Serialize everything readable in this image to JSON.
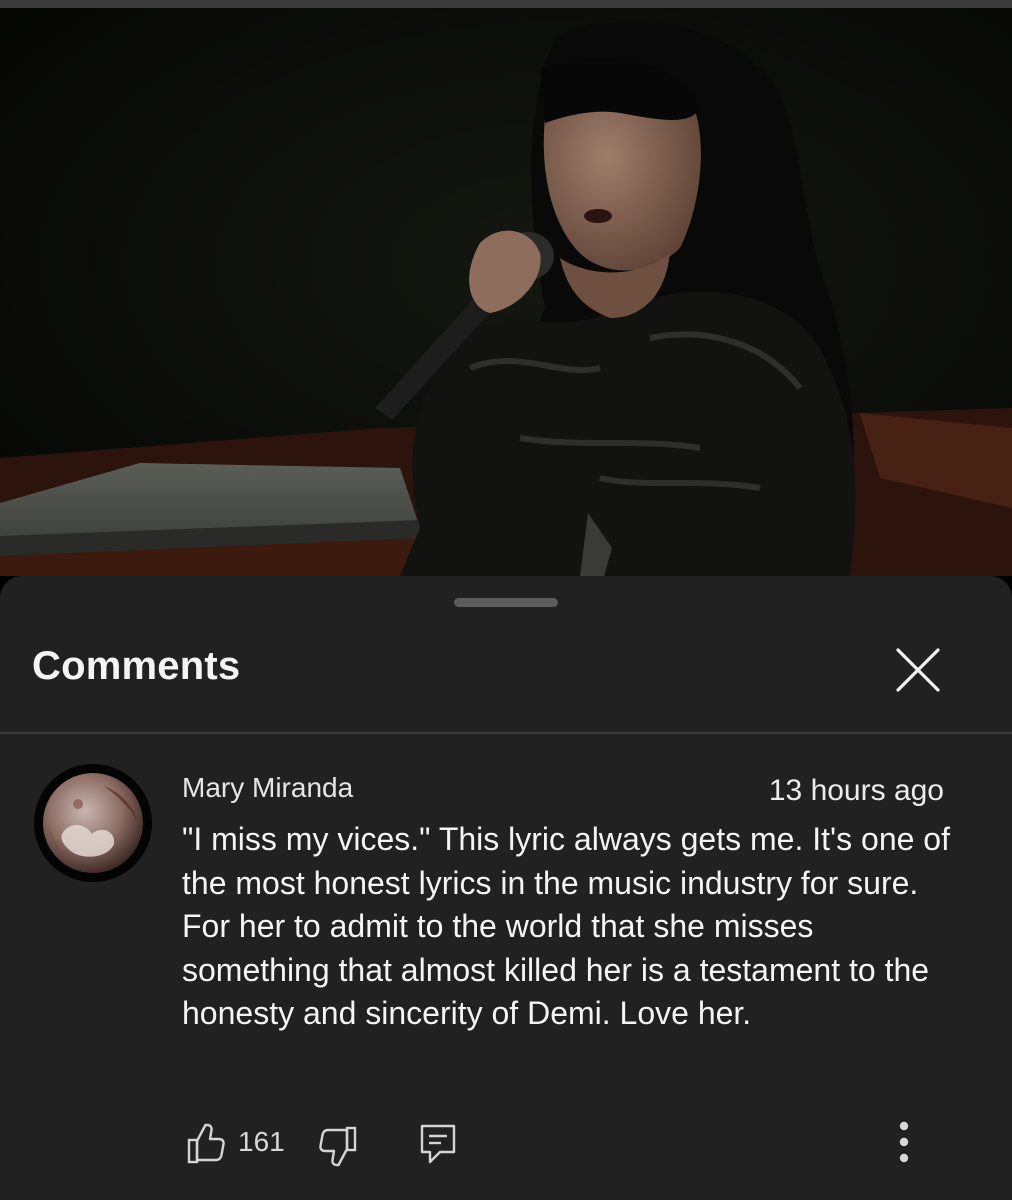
{
  "sheet": {
    "title": "Comments"
  },
  "icons": {
    "close": "close-icon",
    "like": "thumbs-up-icon",
    "dislike": "thumbs-down-icon",
    "reply": "reply-icon",
    "more": "more-vertical-icon"
  },
  "comment": {
    "author": "Mary Miranda",
    "timestamp": "13 hours ago",
    "text": "\"I miss my vices.\" This lyric always gets me. It's one of the most honest lyrics in the music industry for sure. For her to admit to the world that she misses something that almost killed her is a testament to the honesty and sincerity of Demi. Love her.",
    "like_count": "161"
  },
  "colors": {
    "sheet_background": "#212121",
    "page_background": "#000000",
    "divider": "#3b3b3b",
    "text_primary": "#f4f4f4"
  }
}
